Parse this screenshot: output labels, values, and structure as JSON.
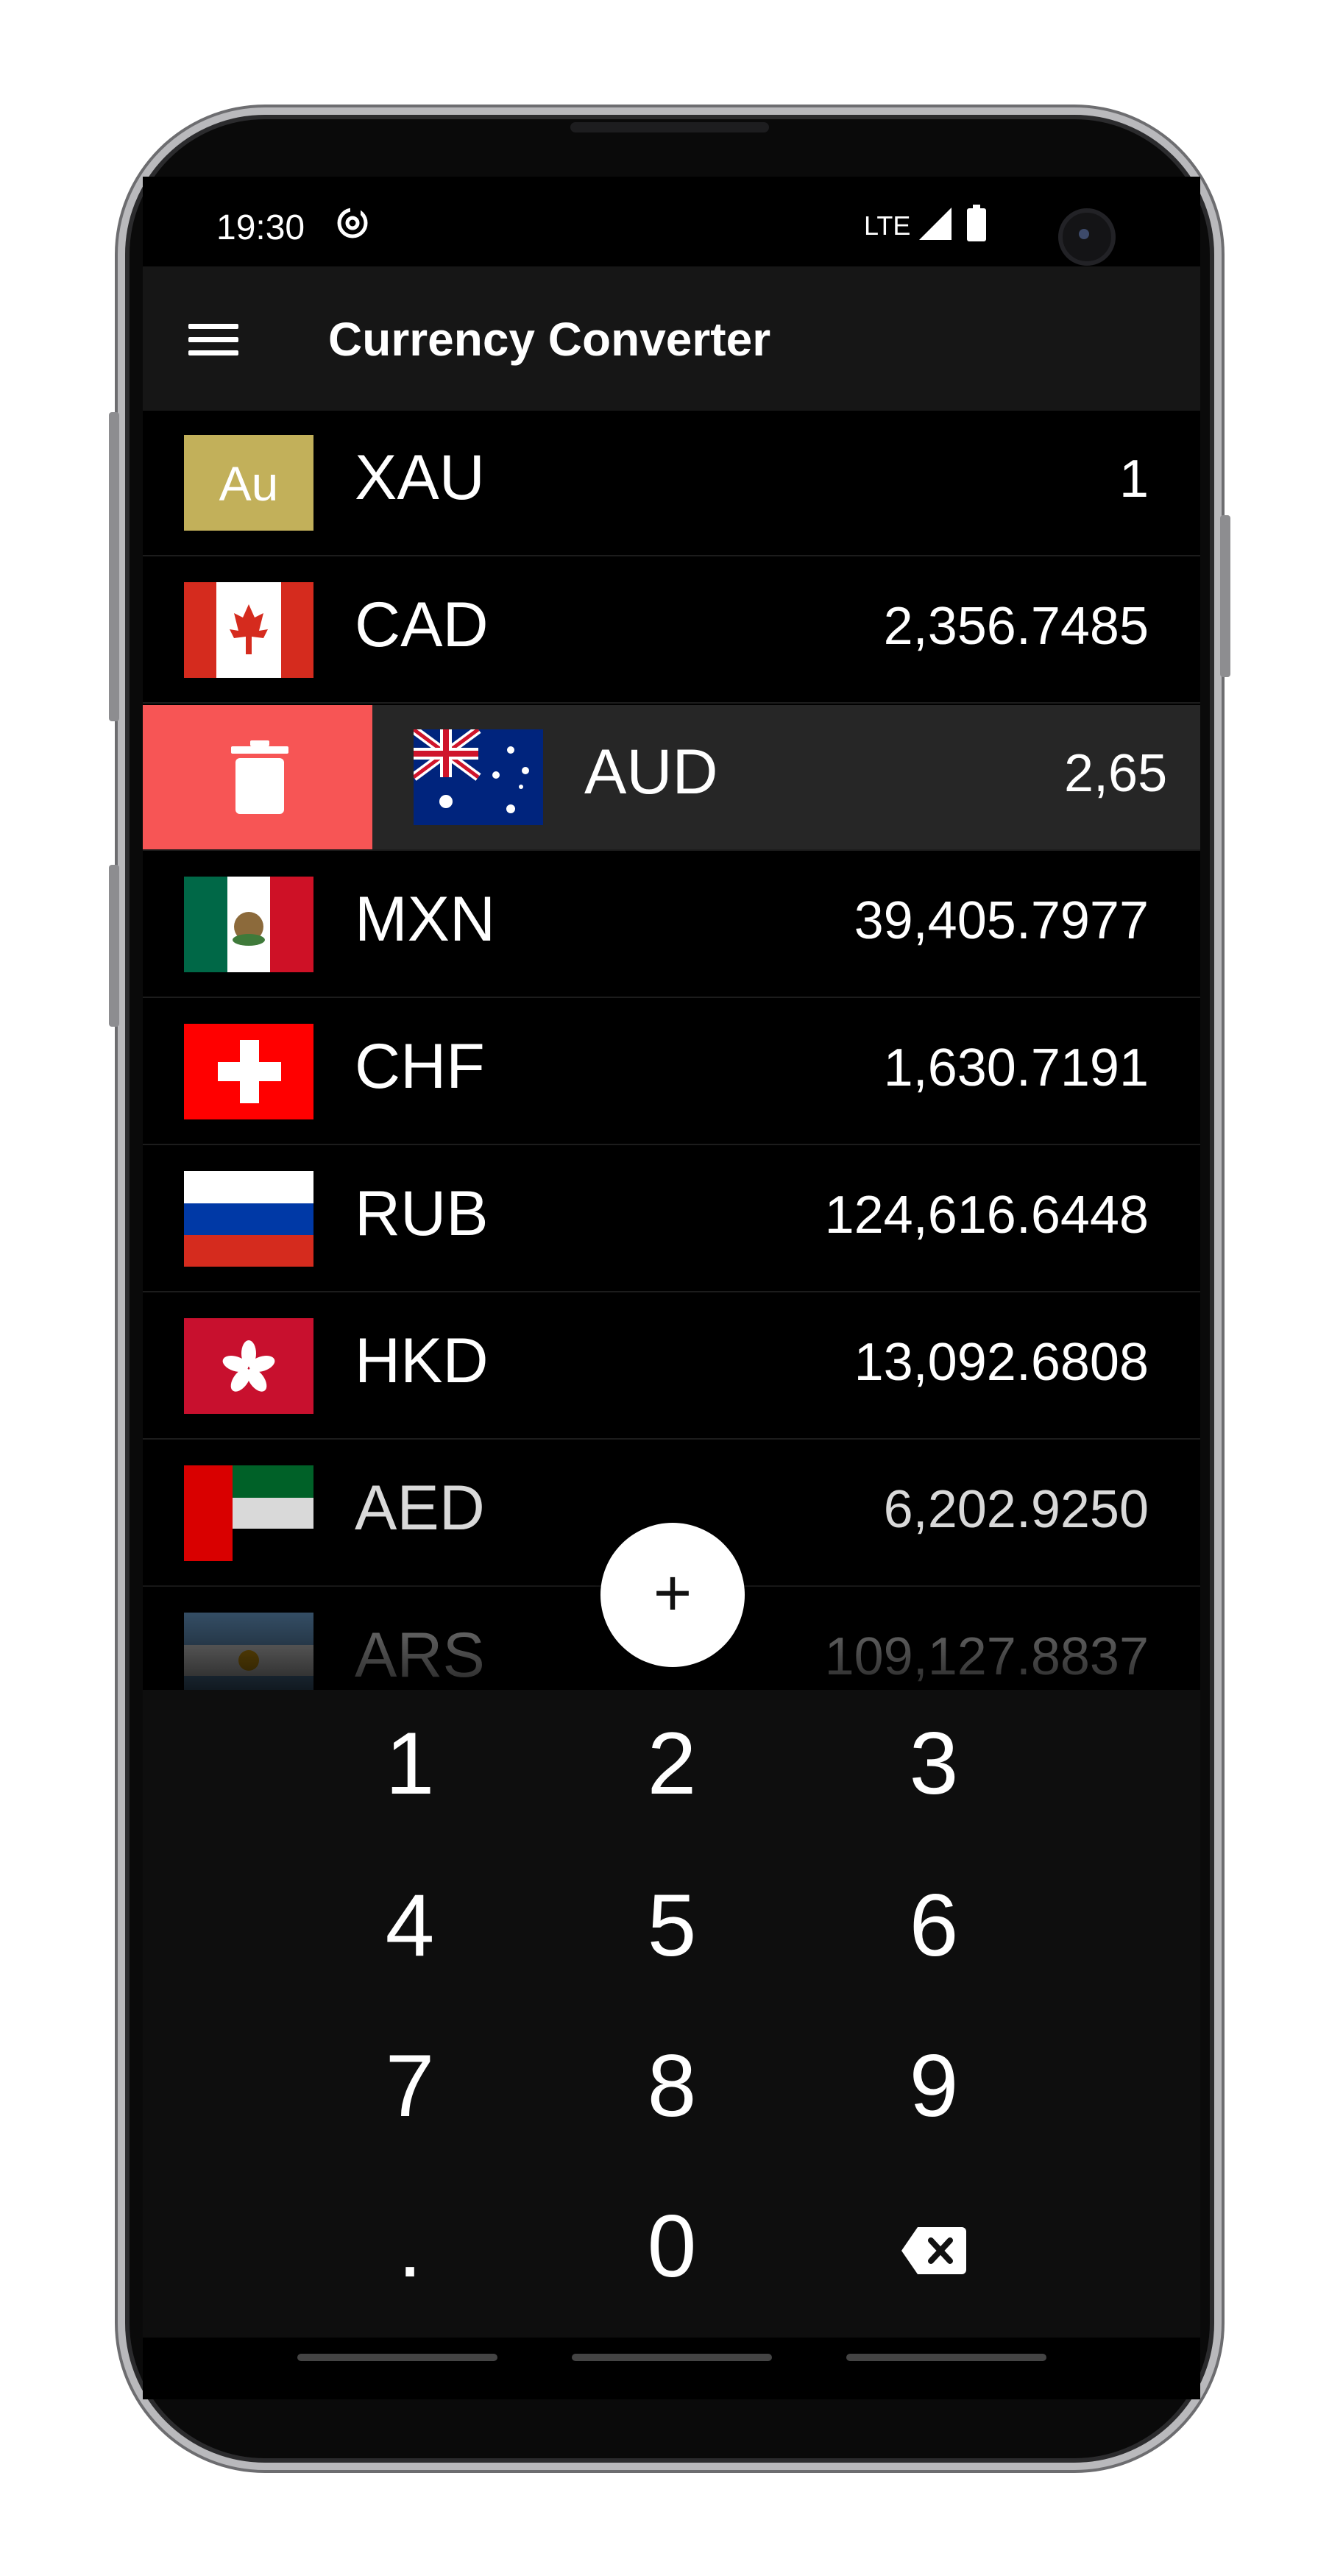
{
  "status_bar": {
    "time": "19:30",
    "network": "LTE"
  },
  "app_bar": {
    "title": "Currency Converter"
  },
  "colors": {
    "accent_delete": "#f75555",
    "gold_badge": "#c2b05a",
    "background": "#000000"
  },
  "currencies": [
    {
      "code": "XAU",
      "value": "1",
      "badge": "Au"
    },
    {
      "code": "CAD",
      "value": "2,356.7485"
    },
    {
      "code": "AUD",
      "value": "2,65",
      "swiped": true
    },
    {
      "code": "MXN",
      "value": "39,405.7977"
    },
    {
      "code": "CHF",
      "value": "1,630.7191"
    },
    {
      "code": "RUB",
      "value": "124,616.6448"
    },
    {
      "code": "HKD",
      "value": "13,092.6808"
    },
    {
      "code": "AED",
      "value": "6,202.9250"
    },
    {
      "code": "ARS",
      "value": "109,127.8837"
    }
  ],
  "fab": {
    "label": "+"
  },
  "keypad": {
    "keys": [
      "1",
      "2",
      "3",
      "4",
      "5",
      "6",
      "7",
      "8",
      "9",
      ".",
      "0"
    ]
  }
}
